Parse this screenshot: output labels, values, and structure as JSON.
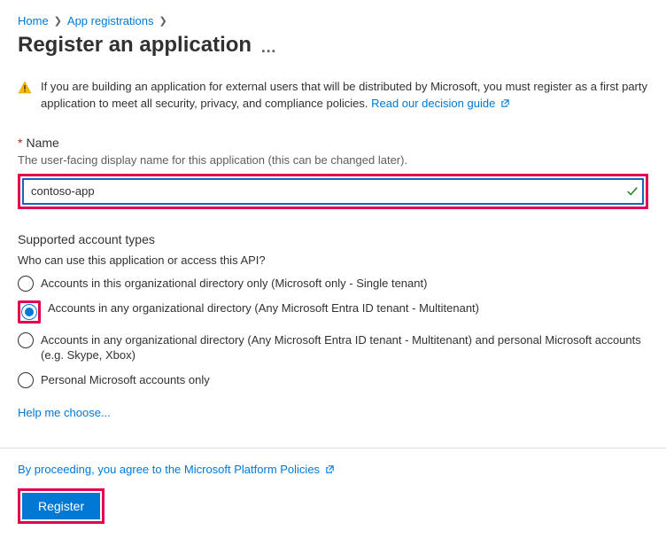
{
  "breadcrumb": {
    "home": "Home",
    "app_reg": "App registrations"
  },
  "page": {
    "title": "Register an application"
  },
  "warning": {
    "text": "If you are building an application for external users that will be distributed by Microsoft, you must register as a first party application to meet all security, privacy, and compliance policies. ",
    "link": "Read our decision guide"
  },
  "name_field": {
    "label": "Name",
    "desc": "The user-facing display name for this application (this can be changed later).",
    "value": "contoso-app"
  },
  "account_types": {
    "title": "Supported account types",
    "question": "Who can use this application or access this API?",
    "options": [
      "Accounts in this organizational directory only (Microsoft only - Single tenant)",
      "Accounts in any organizational directory (Any Microsoft Entra ID tenant - Multitenant)",
      "Accounts in any organizational directory (Any Microsoft Entra ID tenant - Multitenant) and personal Microsoft accounts (e.g. Skype, Xbox)",
      "Personal Microsoft accounts only"
    ],
    "selected_index": 1,
    "help_link": "Help me choose..."
  },
  "footer": {
    "policy_text": "By proceeding, you agree to the Microsoft Platform Policies",
    "register": "Register"
  }
}
